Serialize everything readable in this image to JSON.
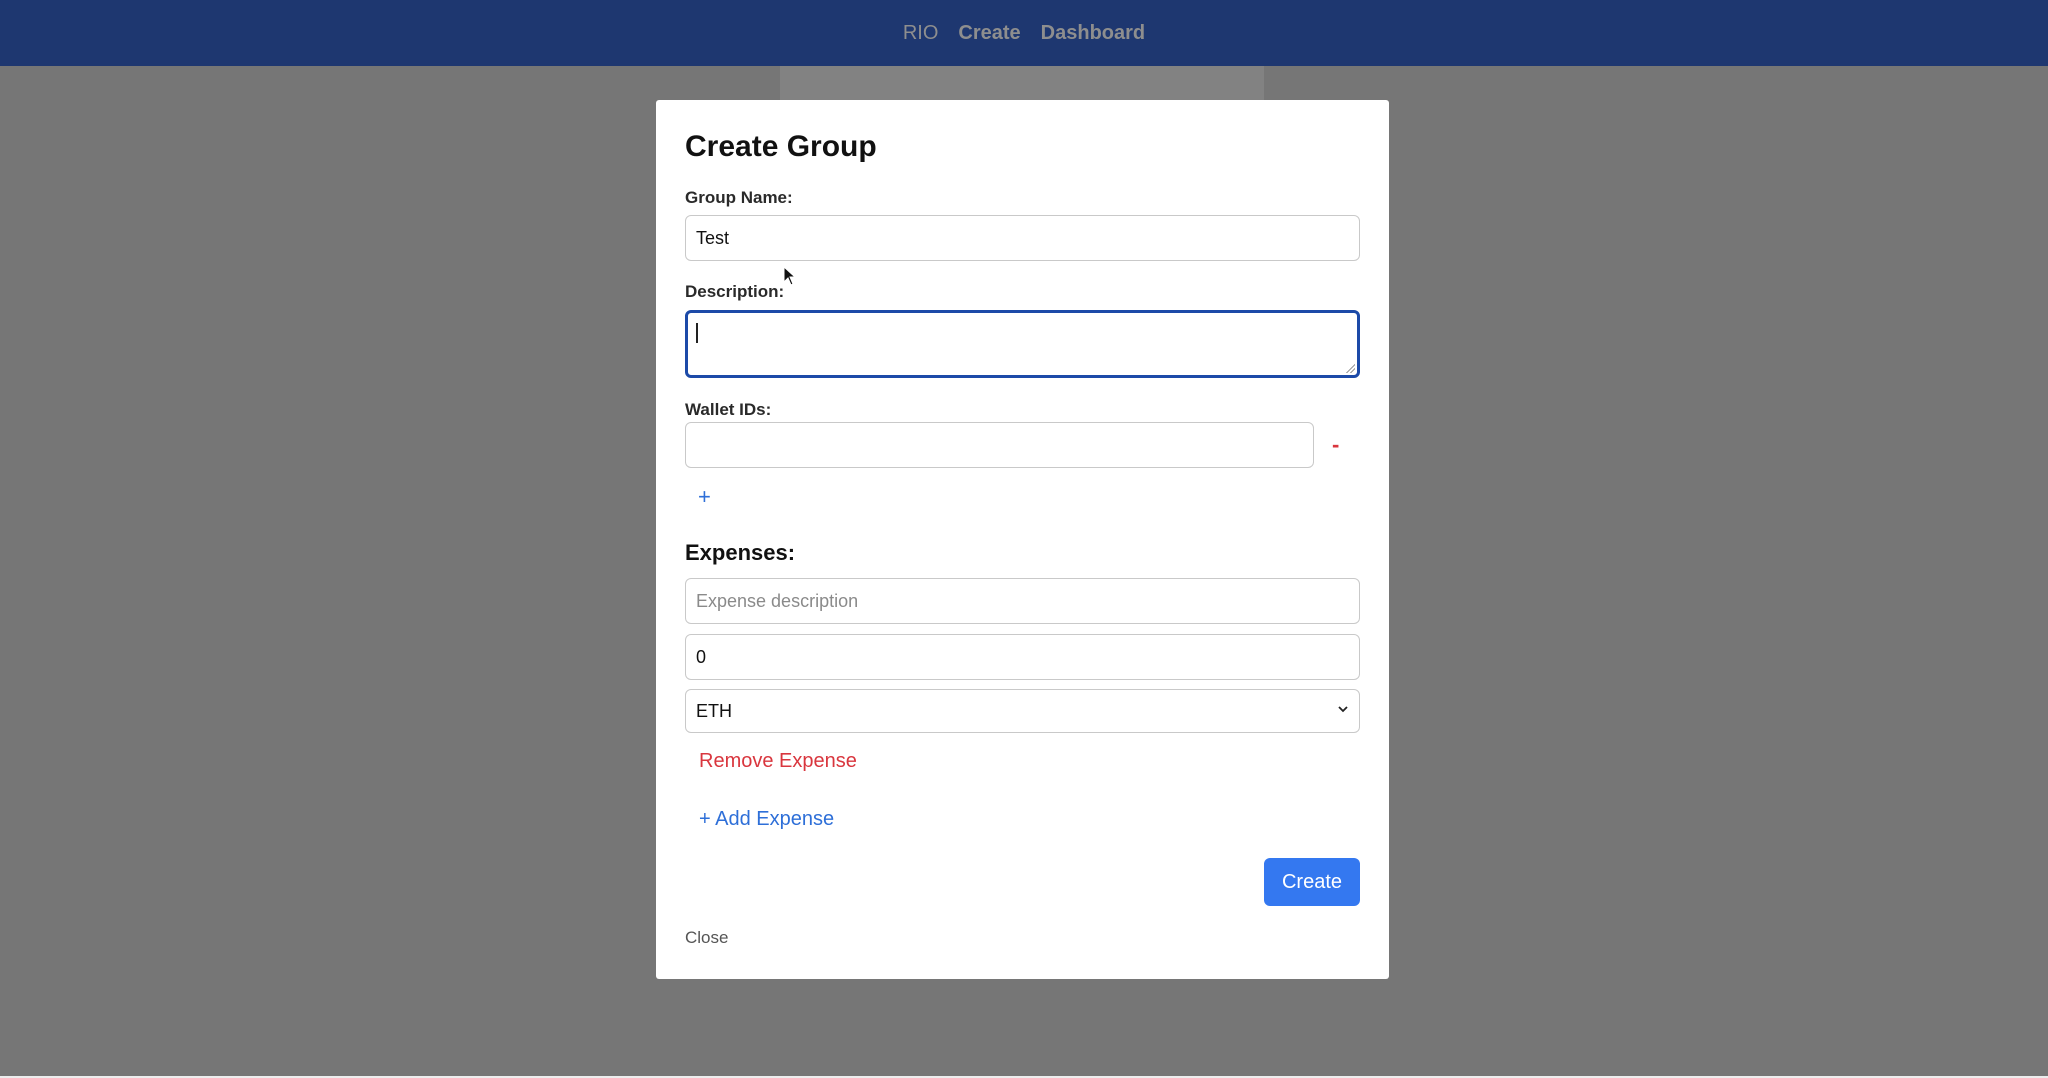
{
  "nav": {
    "brand": "RIO",
    "create": "Create",
    "dashboard": "Dashboard"
  },
  "modal": {
    "title": "Create Group",
    "group_name_label": "Group Name:",
    "group_name_value": "Test",
    "description_label": "Description:",
    "wallet_ids_label": "Wallet IDs:",
    "remove_wallet": "-",
    "add_wallet": "+",
    "expenses_heading": "Expenses:",
    "expense_description_placeholder": "Expense description",
    "expense_amount_value": "0",
    "currency_selected": "ETH",
    "remove_expense": "Remove Expense",
    "add_expense": "+ Add Expense",
    "create_button": "Create",
    "close_link": "Close"
  },
  "colors": {
    "topbar": "#1e3770",
    "overlay": "#767676",
    "primary": "#3478f0",
    "danger": "#d9363e",
    "focus": "#1c4aa8"
  },
  "icons": {
    "select": "chevron-down-icon",
    "pointer": "mouse-cursor-icon"
  }
}
